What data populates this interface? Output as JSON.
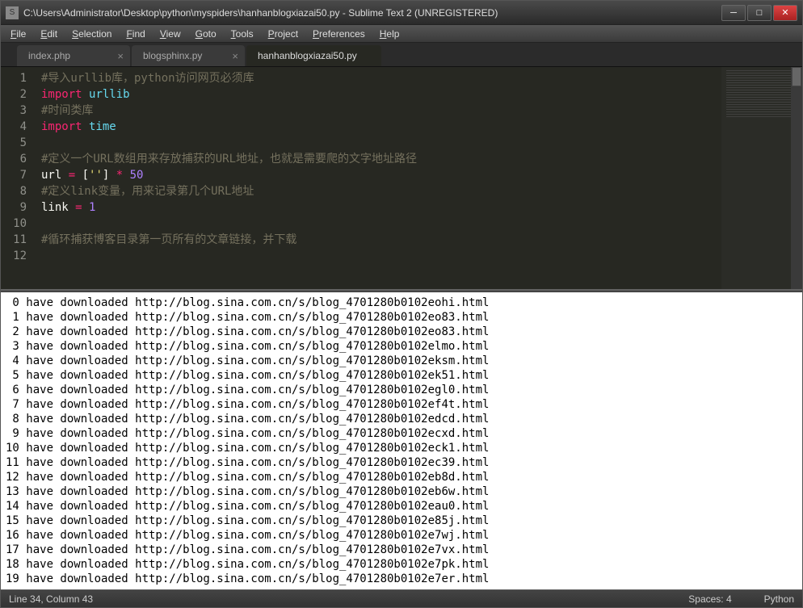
{
  "window": {
    "title": "C:\\Users\\Administrator\\Desktop\\python\\myspiders\\hanhanblogxiazai50.py - Sublime Text 2 (UNREGISTERED)"
  },
  "menus": [
    "File",
    "Edit",
    "Selection",
    "Find",
    "View",
    "Goto",
    "Tools",
    "Project",
    "Preferences",
    "Help"
  ],
  "tabs": [
    {
      "label": "index.php",
      "active": false,
      "closeable": true
    },
    {
      "label": "blogsphinx.py",
      "active": false,
      "closeable": true
    },
    {
      "label": "hanhanblogxiazai50.py",
      "active": true,
      "closeable": false
    }
  ],
  "code": {
    "lines": [
      {
        "n": 1,
        "tokens": [
          {
            "t": "#导入urllib库，python访问网页必须库",
            "c": "comment"
          }
        ]
      },
      {
        "n": 2,
        "tokens": [
          {
            "t": "import",
            "c": "keyword"
          },
          {
            "t": " ",
            "c": "plain"
          },
          {
            "t": "urllib",
            "c": "ident"
          }
        ]
      },
      {
        "n": 3,
        "tokens": [
          {
            "t": "#时间类库",
            "c": "comment"
          }
        ]
      },
      {
        "n": 4,
        "tokens": [
          {
            "t": "import",
            "c": "keyword"
          },
          {
            "t": " ",
            "c": "plain"
          },
          {
            "t": "time",
            "c": "ident"
          }
        ]
      },
      {
        "n": 5,
        "tokens": []
      },
      {
        "n": 6,
        "tokens": [
          {
            "t": "#定义一个URL数组用来存放捕获的URL地址，也就是需要爬的文字地址路径",
            "c": "comment"
          }
        ]
      },
      {
        "n": 7,
        "tokens": [
          {
            "t": "url ",
            "c": "plain"
          },
          {
            "t": "=",
            "c": "op"
          },
          {
            "t": " [",
            "c": "plain"
          },
          {
            "t": "''",
            "c": "string"
          },
          {
            "t": "] ",
            "c": "plain"
          },
          {
            "t": "*",
            "c": "op"
          },
          {
            "t": " ",
            "c": "plain"
          },
          {
            "t": "50",
            "c": "num"
          }
        ]
      },
      {
        "n": 8,
        "tokens": [
          {
            "t": "#定义link变量，用来记录第几个URL地址",
            "c": "comment"
          }
        ]
      },
      {
        "n": 9,
        "tokens": [
          {
            "t": "link ",
            "c": "plain"
          },
          {
            "t": "=",
            "c": "op"
          },
          {
            "t": " ",
            "c": "plain"
          },
          {
            "t": "1",
            "c": "num"
          }
        ]
      },
      {
        "n": 10,
        "tokens": []
      },
      {
        "n": 11,
        "tokens": [
          {
            "t": "#循环捕获博客目录第一页所有的文章链接，并下载",
            "c": "comment"
          }
        ]
      },
      {
        "n": 12,
        "tokens": []
      }
    ]
  },
  "console_lines": [
    " 0 have downloaded http://blog.sina.com.cn/s/blog_4701280b0102eohi.html",
    " 1 have downloaded http://blog.sina.com.cn/s/blog_4701280b0102eo83.html",
    " 2 have downloaded http://blog.sina.com.cn/s/blog_4701280b0102eo83.html",
    " 3 have downloaded http://blog.sina.com.cn/s/blog_4701280b0102elmo.html",
    " 4 have downloaded http://blog.sina.com.cn/s/blog_4701280b0102eksm.html",
    " 5 have downloaded http://blog.sina.com.cn/s/blog_4701280b0102ek51.html",
    " 6 have downloaded http://blog.sina.com.cn/s/blog_4701280b0102egl0.html",
    " 7 have downloaded http://blog.sina.com.cn/s/blog_4701280b0102ef4t.html",
    " 8 have downloaded http://blog.sina.com.cn/s/blog_4701280b0102edcd.html",
    " 9 have downloaded http://blog.sina.com.cn/s/blog_4701280b0102ecxd.html",
    "10 have downloaded http://blog.sina.com.cn/s/blog_4701280b0102eck1.html",
    "11 have downloaded http://blog.sina.com.cn/s/blog_4701280b0102ec39.html",
    "12 have downloaded http://blog.sina.com.cn/s/blog_4701280b0102eb8d.html",
    "13 have downloaded http://blog.sina.com.cn/s/blog_4701280b0102eb6w.html",
    "14 have downloaded http://blog.sina.com.cn/s/blog_4701280b0102eau0.html",
    "15 have downloaded http://blog.sina.com.cn/s/blog_4701280b0102e85j.html",
    "16 have downloaded http://blog.sina.com.cn/s/blog_4701280b0102e7wj.html",
    "17 have downloaded http://blog.sina.com.cn/s/blog_4701280b0102e7vx.html",
    "18 have downloaded http://blog.sina.com.cn/s/blog_4701280b0102e7pk.html",
    "19 have downloaded http://blog.sina.com.cn/s/blog_4701280b0102e7er.html"
  ],
  "statusbar": {
    "left": "Line 34, Column 43",
    "spaces": "Spaces: 4",
    "lang": "Python"
  }
}
